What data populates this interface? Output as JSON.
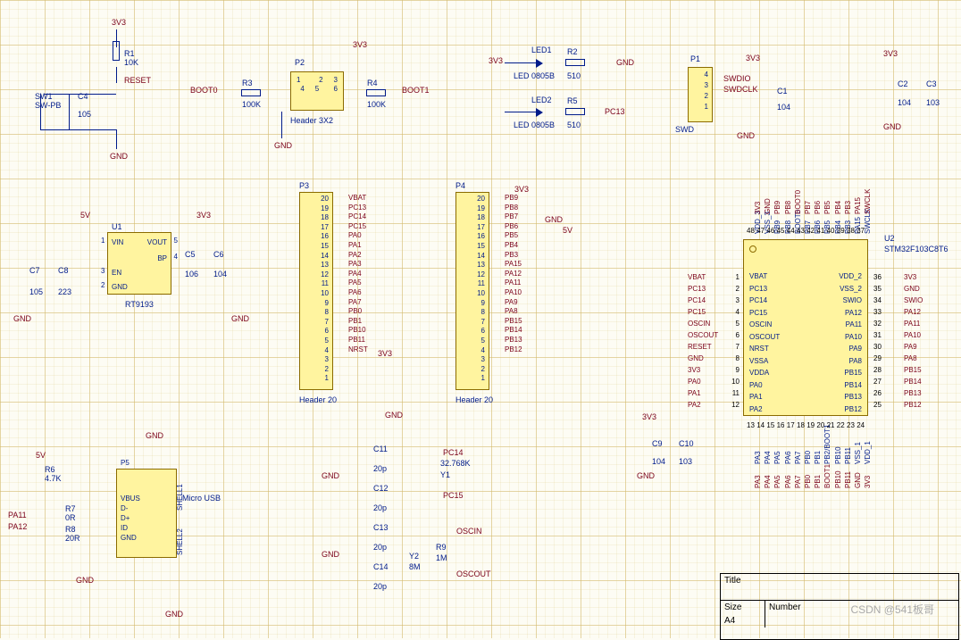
{
  "power": {
    "v33": "3V3",
    "v5": "5V",
    "gnd": "GND"
  },
  "reset": {
    "r1": {
      "ref": "R1",
      "val": "10K"
    },
    "c4": {
      "ref": "C4",
      "val": "105"
    },
    "sw": {
      "ref": "SW1",
      "val": "SW-PB"
    },
    "net": "RESET"
  },
  "boot": {
    "net_l": "BOOT0",
    "net_r": "BOOT1",
    "r3": {
      "ref": "R3",
      "val": "100K"
    },
    "r4": {
      "ref": "R4",
      "val": "100K"
    },
    "p2": {
      "ref": "P2",
      "type": "Header 3X2",
      "pins": [
        "1",
        "2",
        "3",
        "4",
        "5",
        "6"
      ]
    }
  },
  "leds": {
    "led1": {
      "ref": "LED1",
      "val": "LED 0805B"
    },
    "led2": {
      "ref": "LED2",
      "val": "LED 0805B"
    },
    "r2": {
      "ref": "R2",
      "val": "510"
    },
    "r5": {
      "ref": "R5",
      "val": "510"
    },
    "net2": "PC13"
  },
  "swd": {
    "p1": {
      "ref": "P1",
      "pins": [
        "1",
        "2",
        "3",
        "4"
      ]
    },
    "c1": {
      "ref": "C1",
      "val": "104"
    },
    "swdio": "SWDIO",
    "swdclk": "SWDCLK",
    "type": "SWD"
  },
  "decouple": {
    "c2": {
      "ref": "C2",
      "val": "104"
    },
    "c3": {
      "ref": "C3",
      "val": "103"
    }
  },
  "reg": {
    "u1": {
      "ref": "U1",
      "type": "RT9193",
      "pins": {
        "vin": "VIN",
        "vout": "VOUT",
        "bp": "BP",
        "en": "EN",
        "gnd": "GND"
      }
    },
    "c5": {
      "ref": "C5",
      "val": "106"
    },
    "c6": {
      "ref": "C6",
      "val": "104"
    },
    "c7": {
      "ref": "C7",
      "val": "105"
    },
    "c8": {
      "ref": "C8",
      "val": "223"
    }
  },
  "hdr_p3": {
    "ref": "P3",
    "type": "Header 20",
    "nets_r": [
      "VBAT",
      "PC13",
      "PC14",
      "PC15",
      "PA0",
      "PA1",
      "PA2",
      "PA3",
      "PA4",
      "PA5",
      "PA6",
      "PA7",
      "PB0",
      "PB1",
      "PB10",
      "PB11",
      "NRST",
      "",
      "",
      ""
    ],
    "nums": [
      "20",
      "19",
      "18",
      "17",
      "16",
      "15",
      "14",
      "13",
      "12",
      "11",
      "10",
      "9",
      "8",
      "7",
      "6",
      "5",
      "4",
      "3",
      "2",
      "1"
    ]
  },
  "hdr_p4": {
    "ref": "P4",
    "type": "Header 20",
    "nets_r": [
      "",
      "",
      "PB9",
      "PB8",
      "PB7",
      "PB6",
      "PB5",
      "PB4",
      "PB3",
      "PA15",
      "PA12",
      "PA11",
      "PA10",
      "PA9",
      "PA8",
      "PB15",
      "PB14",
      "PB13",
      "PB12",
      ""
    ],
    "nums": [
      "20",
      "19",
      "18",
      "17",
      "16",
      "15",
      "14",
      "13",
      "12",
      "11",
      "10",
      "9",
      "8",
      "7",
      "6",
      "5",
      "4",
      "3",
      "2",
      "1"
    ]
  },
  "usb": {
    "ref": "P5",
    "type": "Micro USB",
    "pins": [
      "VBUS",
      "D-",
      "D+",
      "ID",
      "GND"
    ],
    "shell": [
      "SHELL1",
      "SHELL2"
    ],
    "r6": {
      "ref": "R6",
      "val": "4.7K"
    },
    "r7": {
      "ref": "R7",
      "val": "0R"
    },
    "r8": {
      "ref": "R8",
      "val": "20R"
    },
    "net_a11": "PA11",
    "net_a12": "PA12"
  },
  "xtal32": {
    "c11": {
      "ref": "C11",
      "val": "20p"
    },
    "c12": {
      "ref": "C12",
      "val": "20p"
    },
    "y1": {
      "ref": "Y1",
      "val": "32.768K"
    },
    "net1": "PC14",
    "net2": "PC15"
  },
  "xtal8": {
    "c13": {
      "ref": "C13",
      "val": "20p"
    },
    "c14": {
      "ref": "C14",
      "val": "20p"
    },
    "y2": {
      "ref": "Y2",
      "val": "8M"
    },
    "r9": {
      "ref": "R9",
      "val": "1M"
    },
    "net1": "OSCIN",
    "net2": "OSCOUT"
  },
  "mcu_decouple": {
    "c9": {
      "ref": "C9",
      "val": "104"
    },
    "c10": {
      "ref": "C10",
      "val": "103"
    }
  },
  "mcu": {
    "ref": "U2",
    "type": "STM32F103C8T6",
    "left": [
      {
        "num": "1",
        "name": "VBAT",
        "net": "VBAT"
      },
      {
        "num": "2",
        "name": "PC13",
        "net": "PC13"
      },
      {
        "num": "3",
        "name": "PC14",
        "net": "PC14"
      },
      {
        "num": "4",
        "name": "PC15",
        "net": "PC15"
      },
      {
        "num": "5",
        "name": "OSCIN",
        "net": "OSCIN"
      },
      {
        "num": "6",
        "name": "OSCOUT",
        "net": "OSCOUT"
      },
      {
        "num": "7",
        "name": "NRST",
        "net": "RESET"
      },
      {
        "num": "8",
        "name": "VSSA",
        "net": "GND"
      },
      {
        "num": "9",
        "name": "VDDA",
        "net": "3V3"
      },
      {
        "num": "10",
        "name": "PA0",
        "net": "PA0"
      },
      {
        "num": "11",
        "name": "PA1",
        "net": "PA1"
      },
      {
        "num": "12",
        "name": "PA2",
        "net": "PA2"
      }
    ],
    "right": [
      {
        "num": "36",
        "name": "VDD_2",
        "net": "3V3"
      },
      {
        "num": "35",
        "name": "VSS_2",
        "net": "GND"
      },
      {
        "num": "34",
        "name": "SWIO",
        "net": "SWIO"
      },
      {
        "num": "33",
        "name": "PA12",
        "net": "PA12"
      },
      {
        "num": "32",
        "name": "PA11",
        "net": "PA11"
      },
      {
        "num": "31",
        "name": "PA10",
        "net": "PA10"
      },
      {
        "num": "30",
        "name": "PA9",
        "net": "PA9"
      },
      {
        "num": "29",
        "name": "PA8",
        "net": "PA8"
      },
      {
        "num": "28",
        "name": "PB15",
        "net": "PB15"
      },
      {
        "num": "27",
        "name": "PB14",
        "net": "PB14"
      },
      {
        "num": "26",
        "name": "PB13",
        "net": "PB13"
      },
      {
        "num": "25",
        "name": "PB12",
        "net": "PB12"
      }
    ],
    "top": [
      {
        "num": "48",
        "name": "VDD_3",
        "net": "3V3"
      },
      {
        "num": "47",
        "name": "VSS_3",
        "net": "GND"
      },
      {
        "num": "46",
        "name": "PB9",
        "net": "PB9"
      },
      {
        "num": "45",
        "name": "PB8",
        "net": "PB8"
      },
      {
        "num": "44",
        "name": "BOOT0",
        "net": "BOOT0"
      },
      {
        "num": "43",
        "name": "PB7",
        "net": "PB7"
      },
      {
        "num": "42",
        "name": "PB6",
        "net": "PB6"
      },
      {
        "num": "41",
        "name": "PB5",
        "net": "PB5"
      },
      {
        "num": "40",
        "name": "PB4",
        "net": "PB4"
      },
      {
        "num": "39",
        "name": "PB3",
        "net": "PB3"
      },
      {
        "num": "38",
        "name": "PA15",
        "net": "PA15"
      },
      {
        "num": "37",
        "name": "SWCLK",
        "net": "SWCLK"
      }
    ],
    "bot": [
      {
        "num": "13",
        "name": "PA3",
        "net": "PA3"
      },
      {
        "num": "14",
        "name": "PA4",
        "net": "PA4"
      },
      {
        "num": "15",
        "name": "PA5",
        "net": "PA5"
      },
      {
        "num": "16",
        "name": "PA6",
        "net": "PA6"
      },
      {
        "num": "17",
        "name": "PA7",
        "net": "PA7"
      },
      {
        "num": "18",
        "name": "PB0",
        "net": "PB0"
      },
      {
        "num": "19",
        "name": "PB1",
        "net": "PB1"
      },
      {
        "num": "20",
        "name": "PB2/BOOT1",
        "net": "BOOT1"
      },
      {
        "num": "21",
        "name": "PB10",
        "net": "PB10"
      },
      {
        "num": "22",
        "name": "PB11",
        "net": "PB11"
      },
      {
        "num": "23",
        "name": "VSS_1",
        "net": "GND"
      },
      {
        "num": "24",
        "name": "VDD_1",
        "net": "3V3"
      }
    ]
  },
  "title": {
    "title": "Title",
    "size_lbl": "Size",
    "num_lbl": "Number",
    "size": "A4"
  },
  "watermark": "CSDN @541板哥"
}
